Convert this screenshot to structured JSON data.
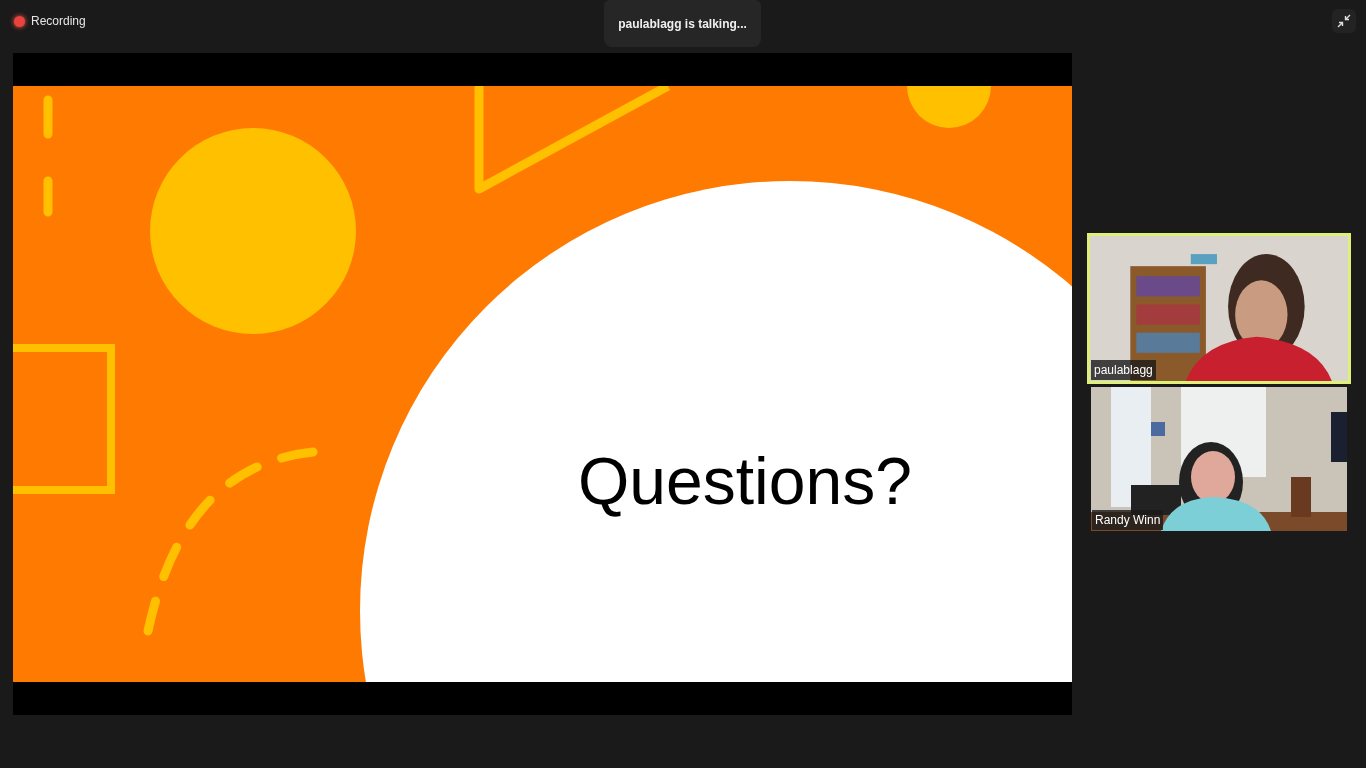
{
  "recording": {
    "label": "Recording"
  },
  "talking_banner": {
    "text": "paulablagg is talking..."
  },
  "slide": {
    "title": "Questions?"
  },
  "participants": [
    {
      "name": "paulablagg",
      "speaking": true
    },
    {
      "name": "Randy Winn",
      "speaking": false
    }
  ]
}
